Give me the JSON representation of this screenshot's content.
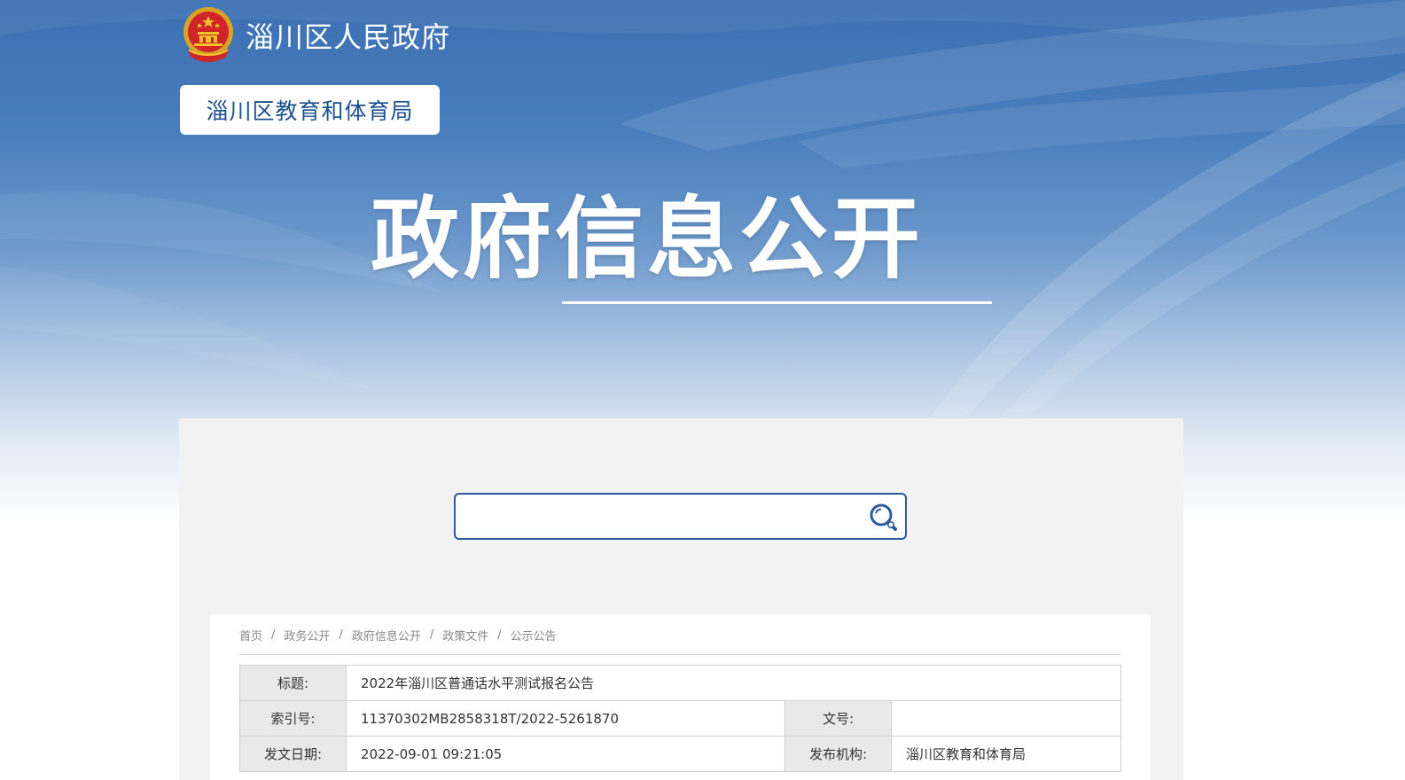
{
  "header": {
    "site_name": "淄川区人民政府",
    "department": "淄川区教育和体育局",
    "big_title": "政府信息公开"
  },
  "search": {
    "placeholder": "",
    "value": "",
    "icon": "search-icon"
  },
  "breadcrumb": {
    "items": [
      "首页",
      "政务公开",
      "政府信息公开",
      "政策文件",
      "公示公告"
    ],
    "separator": "/"
  },
  "meta_table": {
    "title_label": "标题:",
    "title_value": "2022年淄川区普通话水平测试报名公告",
    "index_label": "索引号:",
    "index_value": "11370302MB2858318T/2022-5261870",
    "doc_no_label": "文号:",
    "doc_no_value": "",
    "date_label": "发文日期:",
    "date_value": "2022-09-01 09:21:05",
    "publisher_label": "发布机构:",
    "publisher_value": "淄川区教育和体育局"
  },
  "colors": {
    "banner_top": "#3b6fb2",
    "accent_blue": "#2b5b9a",
    "panel_bg": "#f2f2f2",
    "label_bg": "#e9e9e9"
  }
}
